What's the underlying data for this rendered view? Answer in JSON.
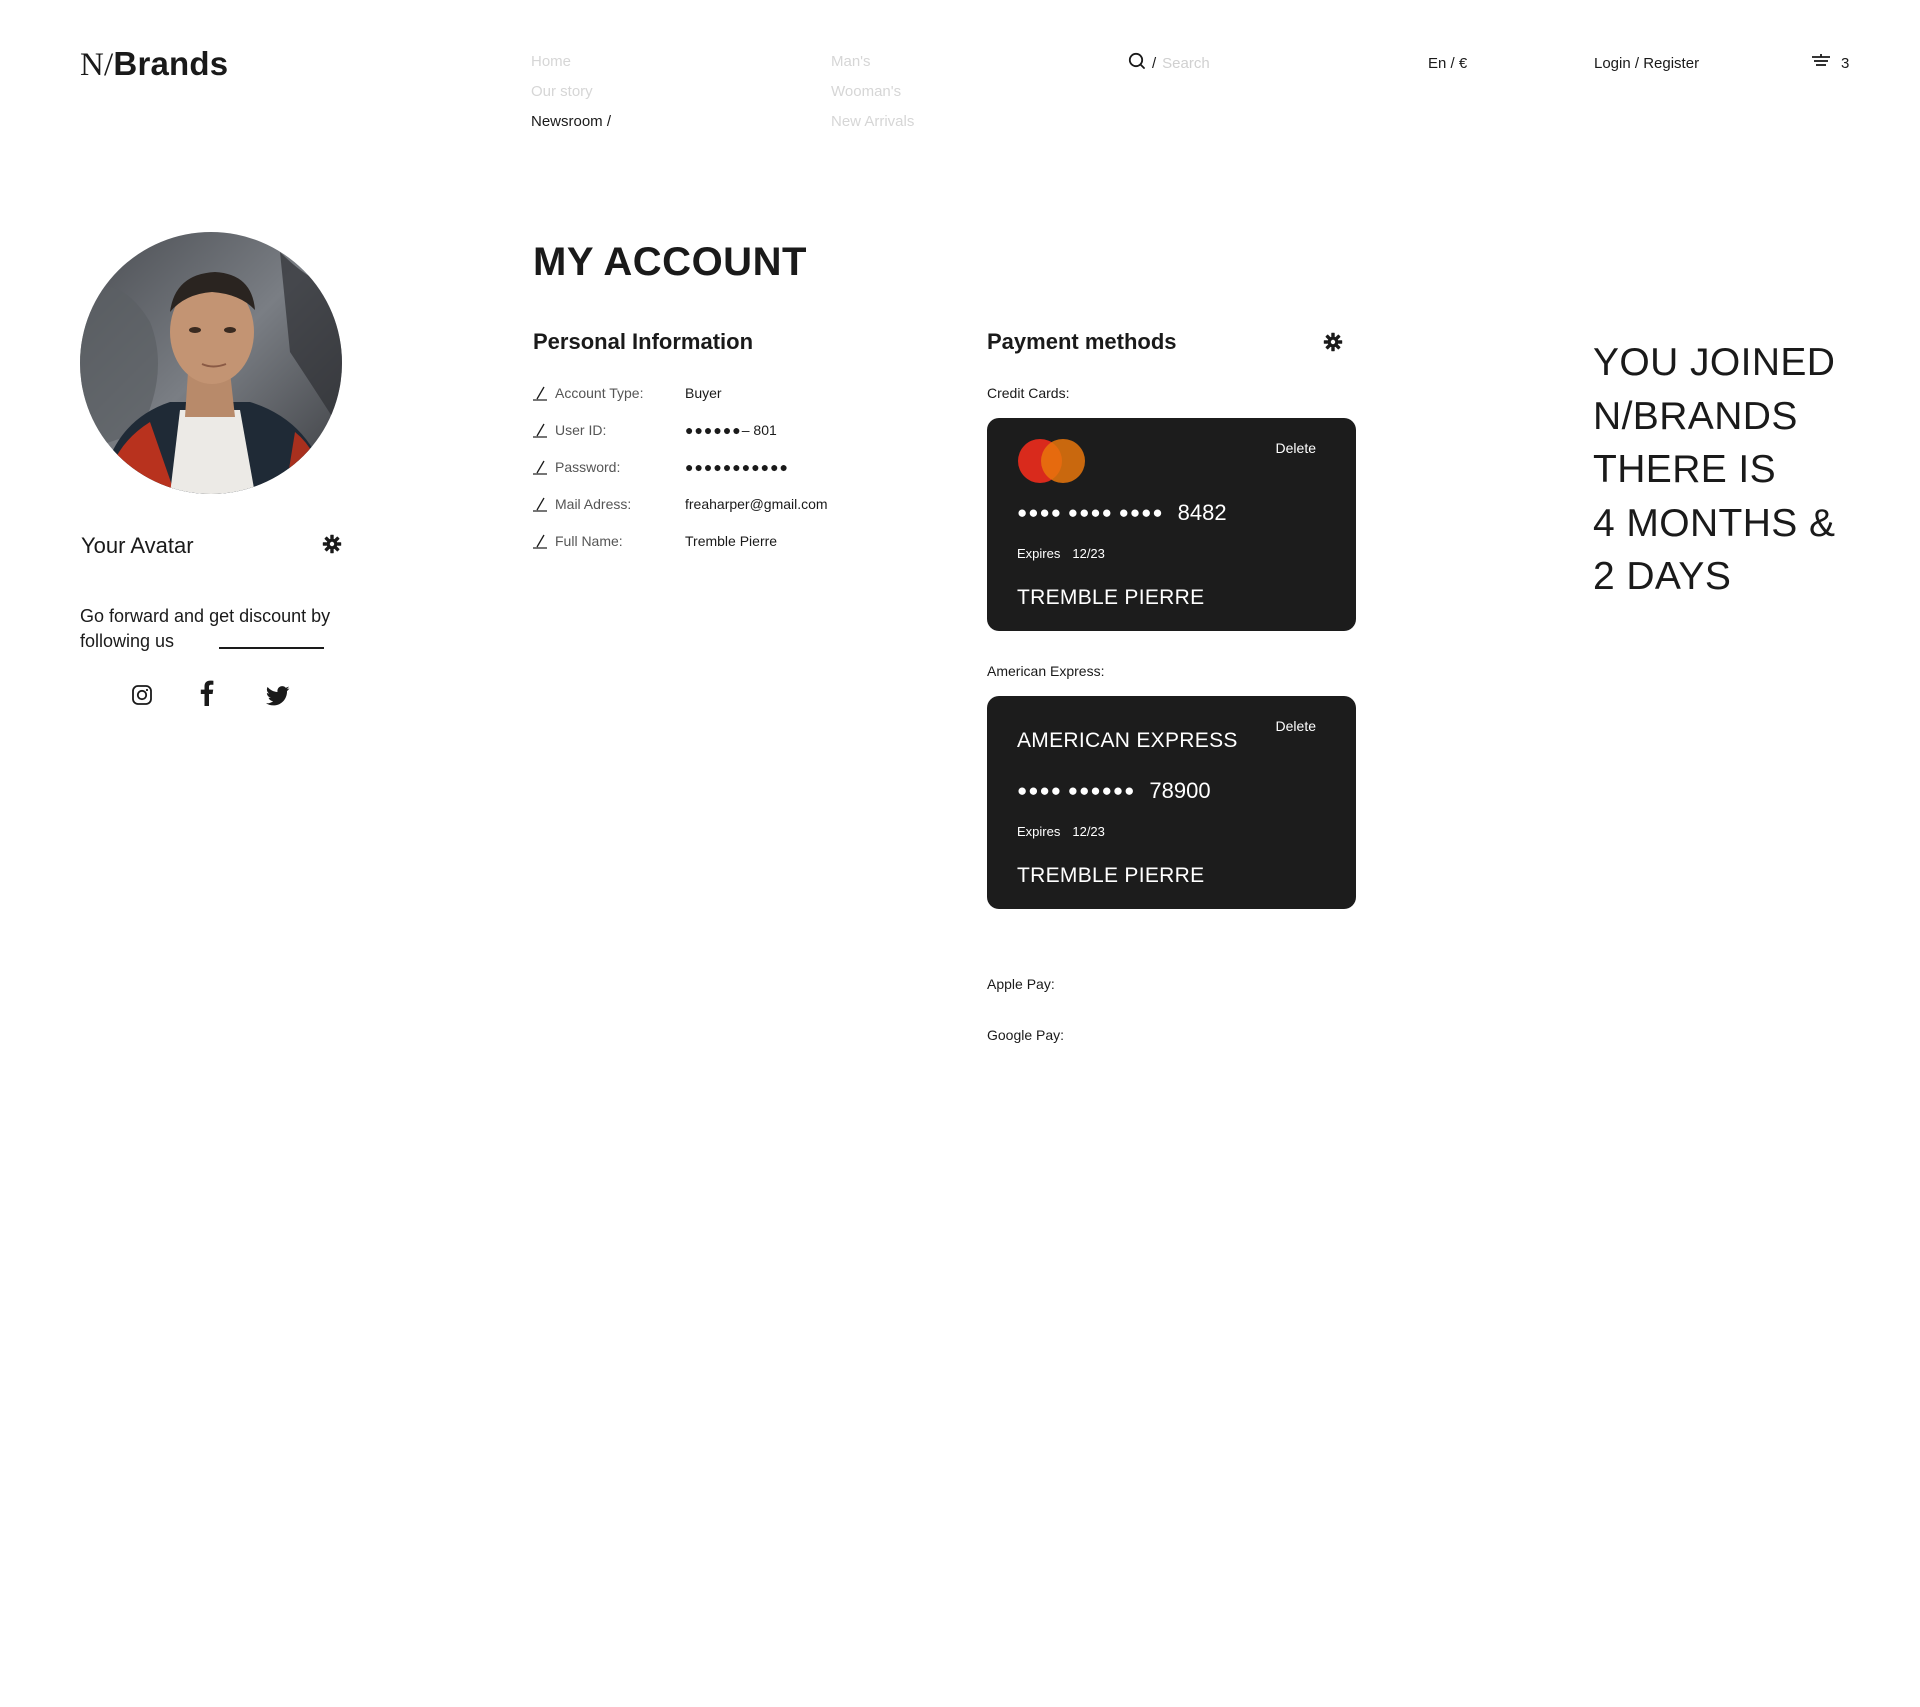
{
  "header": {
    "logo_part1": "N/",
    "logo_part2": "Brands",
    "nav_left": [
      "Home",
      "Our story",
      "Newsroom /"
    ],
    "nav_right": [
      "Man's",
      "Wooman's",
      "New Arrivals"
    ],
    "search_slash": "/",
    "search_placeholder": "Search",
    "lang_currency": "En / €",
    "login": "Login / Register",
    "cart_count": "3"
  },
  "sidebar": {
    "avatar_label": "Your Avatar",
    "follow_text": "Go forward and get discount by following us"
  },
  "main": {
    "title": "MY ACCOUNT",
    "personal": {
      "title": "Personal Information",
      "rows": [
        {
          "label": "Account Type:",
          "value": "Buyer"
        },
        {
          "label": "User ID:",
          "value_dots": "●●●●●●",
          "value": " – 801"
        },
        {
          "label": "Password:",
          "value_dots": "●●●●●●●●●●●"
        },
        {
          "label": "Mail Adress:",
          "value": "freaharper@gmail.com"
        },
        {
          "label": "Full Name:",
          "value": "Tremble Pierre"
        }
      ]
    },
    "payment": {
      "title": "Payment methods",
      "credit_label": "Credit Cards:",
      "credit_card": {
        "delete": "Delete",
        "dots": "●●●● ●●●● ●●●●",
        "last": "8482",
        "expires_label": "Expires",
        "expires": "12/23",
        "holder": "TREMBLE PIERRE"
      },
      "amex_label": "American Express:",
      "amex_card": {
        "delete": "Delete",
        "brand": "AMERICAN EXPRESS",
        "dots": "●●●● ●●●●●●",
        "last": "78900",
        "expires_label": "Expires",
        "expires": "12/23",
        "holder": "TREMBLE PIERRE"
      },
      "apple_pay": "Apple Pay:",
      "google_pay": "Google Pay:"
    }
  },
  "joined": [
    "YOU JOINED",
    "N/BRANDS",
    "THERE IS",
    "4 MONTHS &",
    "2 DAYS"
  ],
  "colors": {
    "card_bg": "#1c1c1c",
    "nav_inactive": "#d6d6d6",
    "mastercard_red": "#d92a1c",
    "mastercard_orange": "#e8760c"
  }
}
